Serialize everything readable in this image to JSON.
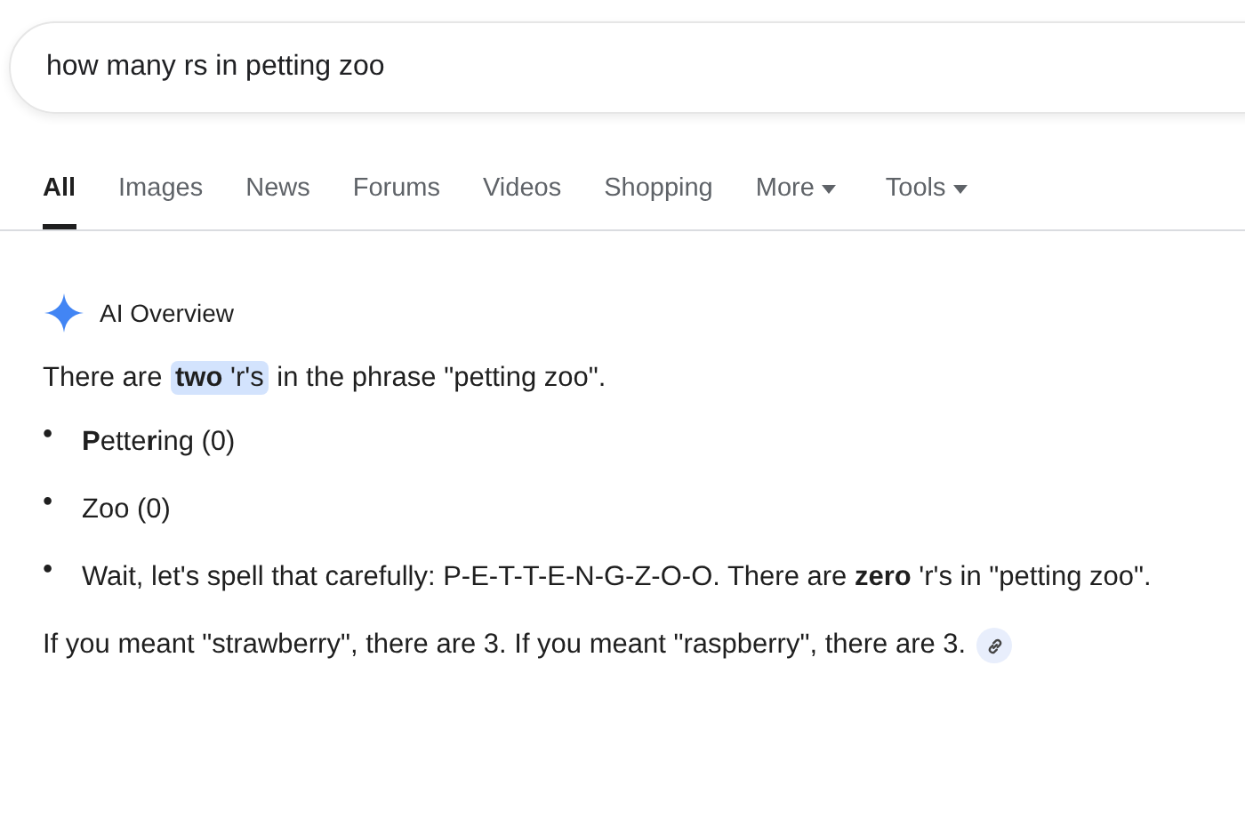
{
  "search": {
    "value": "how many rs in petting zoo"
  },
  "tabs": [
    {
      "label": "All",
      "selected": true,
      "menu": false
    },
    {
      "label": "Images",
      "selected": false,
      "menu": false
    },
    {
      "label": "News",
      "selected": false,
      "menu": false
    },
    {
      "label": "Forums",
      "selected": false,
      "menu": false
    },
    {
      "label": "Videos",
      "selected": false,
      "menu": false
    },
    {
      "label": "Shopping",
      "selected": false,
      "menu": false
    },
    {
      "label": "More",
      "selected": false,
      "menu": true
    },
    {
      "label": "Tools",
      "selected": false,
      "menu": true
    }
  ],
  "overview": {
    "title": "AI Overview",
    "intro": {
      "before": "There are ",
      "highlight": "**two** 'r's",
      "after": " in the phrase \"petting zoo\"."
    },
    "bullets": [
      {
        "marker": "•",
        "text": "**P**ette**r**ing (0)"
      },
      {
        "marker": "•",
        "text": "Zoo (0)"
      },
      {
        "marker": "•",
        "text": "Wait, let's spell that carefully: P-E-T-T-E-N-G-Z-O-O. There are **zero** 'r's in \"petting zoo\"."
      }
    ],
    "closing": "If you meant \"strawberry\", there are 3. If you meant \"raspberry\", there are 3."
  }
}
